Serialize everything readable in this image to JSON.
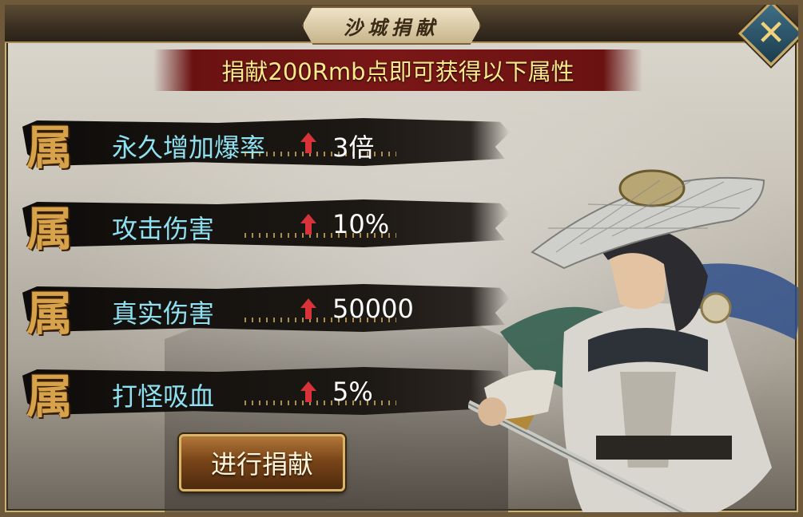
{
  "window": {
    "title": "沙城捐献"
  },
  "banner": {
    "text": "捐献200Rmb点即可获得以下属性"
  },
  "attributes": [
    {
      "glyph": "属",
      "name": "永久增加爆率",
      "value": "3倍"
    },
    {
      "glyph": "属",
      "name": "攻击伤害",
      "value": "10%"
    },
    {
      "glyph": "属",
      "name": "真实伤害",
      "value": "50000"
    },
    {
      "glyph": "属",
      "name": "打怪吸血",
      "value": "5%"
    }
  ],
  "buttons": {
    "donate_label": "进行捐献",
    "close_label": "✕"
  },
  "icons": {
    "close": "close-icon",
    "arrow": "up-arrow-icon",
    "hero": "swordsman-character"
  },
  "colors": {
    "banner_bg": "#7a1717",
    "banner_text": "#ffe98a",
    "attr_name": "#8fe0f0",
    "glyph": "#d6a24a",
    "value": "#ffffff"
  }
}
